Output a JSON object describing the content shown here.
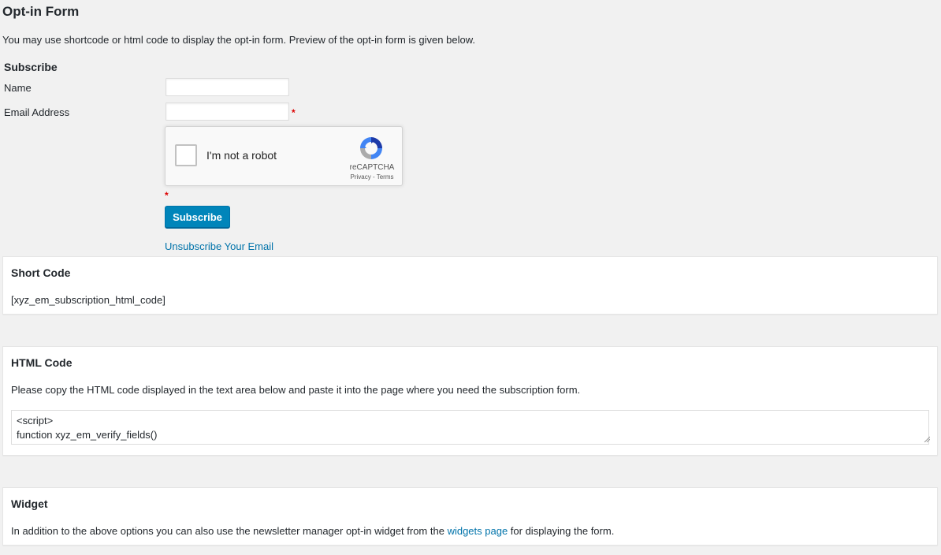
{
  "page": {
    "title": "Opt-in Form",
    "intro": "You may use shortcode or html code to display the opt-in form. Preview of the opt-in form is given below."
  },
  "form": {
    "heading": "Subscribe",
    "name_label": "Name",
    "name_value": "",
    "email_label": "Email Address",
    "email_value": "",
    "required_mark": "*",
    "captcha": {
      "label": "I'm not a robot",
      "brand": "reCAPTCHA",
      "links": "Privacy - Terms",
      "icon": "recaptcha-logo-icon"
    },
    "submit_label": "Subscribe",
    "unsubscribe_link": "Unsubscribe Your Email"
  },
  "shortcode": {
    "heading": "Short Code",
    "code": "[xyz_em_subscription_html_code]"
  },
  "html_code": {
    "heading": "HTML Code",
    "description": "Please copy the HTML code displayed in the text area below and paste it into the page where you need the subscription form.",
    "textarea_value": "<script>\nfunction xyz_em_verify_fields()"
  },
  "widget": {
    "heading": "Widget",
    "text_before": "In addition to the above options you can also use the newsletter manager opt-in widget from the ",
    "link_text": "widgets page",
    "text_after": " for displaying the form."
  },
  "colors": {
    "primary_button": "#0085ba",
    "link": "#0073aa",
    "required": "#dd0000",
    "background": "#f1f1f1"
  }
}
